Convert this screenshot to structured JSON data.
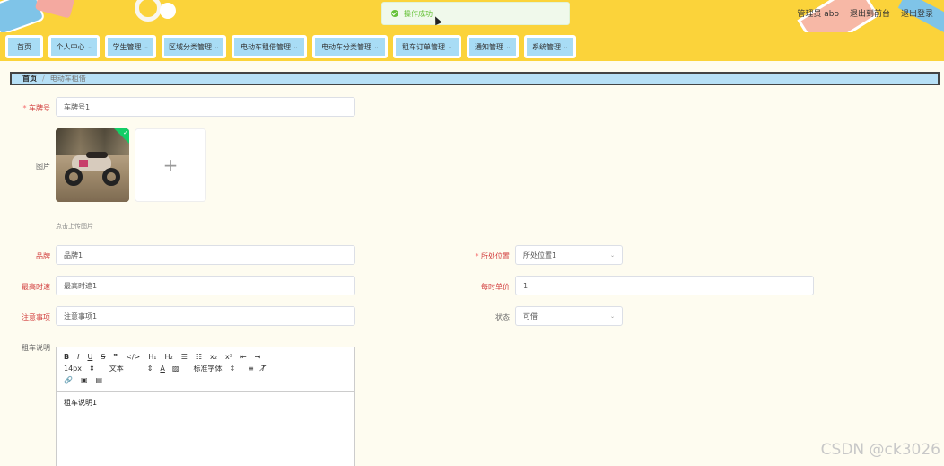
{
  "header": {
    "user_label": "管理员 abo",
    "to_front_label": "退出到前台",
    "logout_label": "退出登录"
  },
  "toast": {
    "message": "操作成功"
  },
  "nav": {
    "items": [
      {
        "label": "首页"
      },
      {
        "label": "个人中心"
      },
      {
        "label": "学生管理"
      },
      {
        "label": "区域分类管理"
      },
      {
        "label": "电动车租借管理"
      },
      {
        "label": "电动车分类管理"
      },
      {
        "label": "租车订单管理"
      },
      {
        "label": "通知管理"
      },
      {
        "label": "系统管理"
      }
    ]
  },
  "breadcrumb": {
    "home": "首页",
    "separator": "/",
    "current": "电动车租借"
  },
  "form": {
    "plate_label": "车牌号",
    "plate_value": "车牌号1",
    "image_label": "图片",
    "upload_hint": "点击上传图片",
    "brand_label": "品牌",
    "brand_value": "品牌1",
    "location_label": "所处位置",
    "location_value": "所处位置1",
    "speed_label": "最高时速",
    "speed_value": "最高时速1",
    "price_label": "每时单价",
    "price_value": "1",
    "notes_label": "注意事项",
    "notes_value": "注意事项1",
    "status_label": "状态",
    "status_value": "可借",
    "desc_label": "租车说明",
    "desc_value": "租车说明1"
  },
  "editor": {
    "font_size": "14px",
    "text_type": "文本",
    "font_family": "标准字体",
    "h1": "H₁",
    "h2": "H₂",
    "sub": "x₂",
    "sup": "x²"
  },
  "watermark": "CSDN @ck3026",
  "colors": {
    "header_bg": "#fbd33a",
    "nav_inner": "#a8dcf5",
    "success": "#67c23a",
    "page_bg": "#fefcf0"
  }
}
